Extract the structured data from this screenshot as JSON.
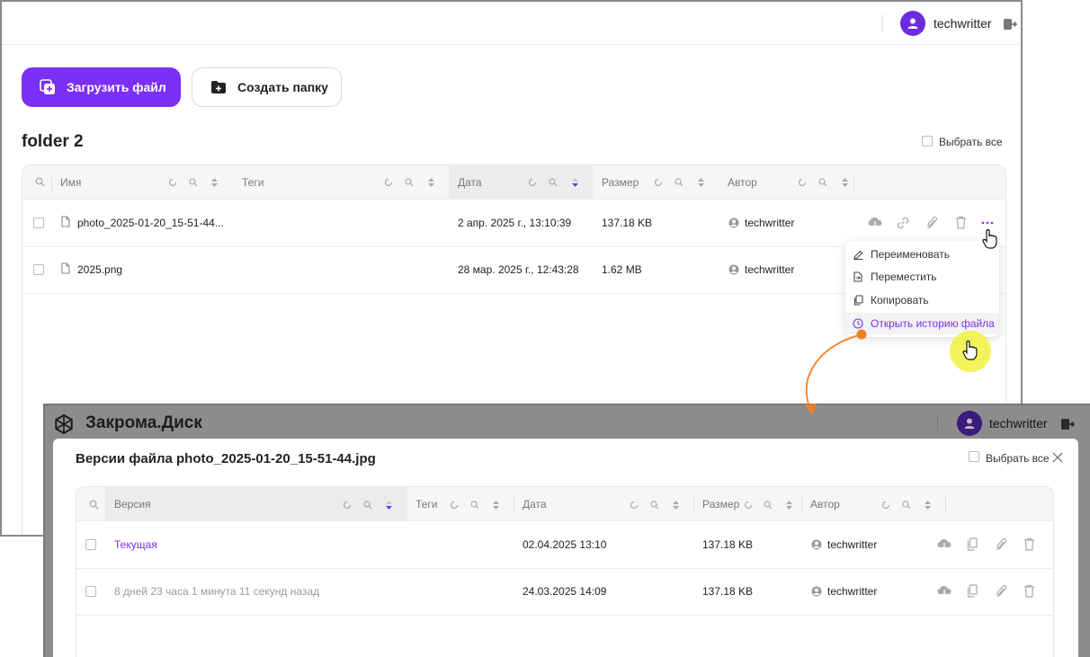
{
  "colors": {
    "accent": "#7b2ff7",
    "avatar": "#6a2cdc",
    "highlight": "#f1f23d",
    "arrow": "#f07f24"
  },
  "main": {
    "user": {
      "name": "techwritter"
    },
    "upload_button": "Загрузить файл",
    "create_folder_button": "Создать папку",
    "folder_title": "folder 2",
    "select_all": "Выбрать все",
    "columns": [
      "Имя",
      "Теги",
      "Дата",
      "Размер",
      "Автор"
    ],
    "rows": [
      {
        "name": "photo_2025-01-20_15-51-44...",
        "tags": "",
        "date": "2 апр. 2025 г., 13:10:39",
        "size": "137.18 KB",
        "author": "techwritter"
      },
      {
        "name": "2025.png",
        "tags": "",
        "date": "28 мар. 2025 г., 12:43:28",
        "size": "1.62 MB",
        "author": "techwritter"
      }
    ],
    "context_menu": [
      {
        "label": "Переименовать",
        "icon": "pencil-icon"
      },
      {
        "label": "Переместить",
        "icon": "move-icon"
      },
      {
        "label": "Копировать",
        "icon": "copy-icon"
      },
      {
        "label": "Открыть историю файла",
        "icon": "clock-icon",
        "active": true
      }
    ]
  },
  "versions_window": {
    "brand": "Закрома.Диск",
    "user": {
      "name": "techwritter"
    },
    "title": "Версии файла photo_2025-01-20_15-51-44.jpg",
    "select_all": "Выбрать все",
    "columns": [
      "Версия",
      "Теги",
      "Дата",
      "Размер",
      "Автор"
    ],
    "rows": [
      {
        "version": "Текущая",
        "tags": "",
        "date": "02.04.2025 13:10",
        "size": "137.18 KB",
        "author": "techwritter"
      },
      {
        "version": "8 дней 23 часа 1 минута 11 секунд назад",
        "tags": "",
        "date": "24.03.2025 14:09",
        "size": "137.18 KB",
        "author": "techwritter"
      }
    ]
  }
}
